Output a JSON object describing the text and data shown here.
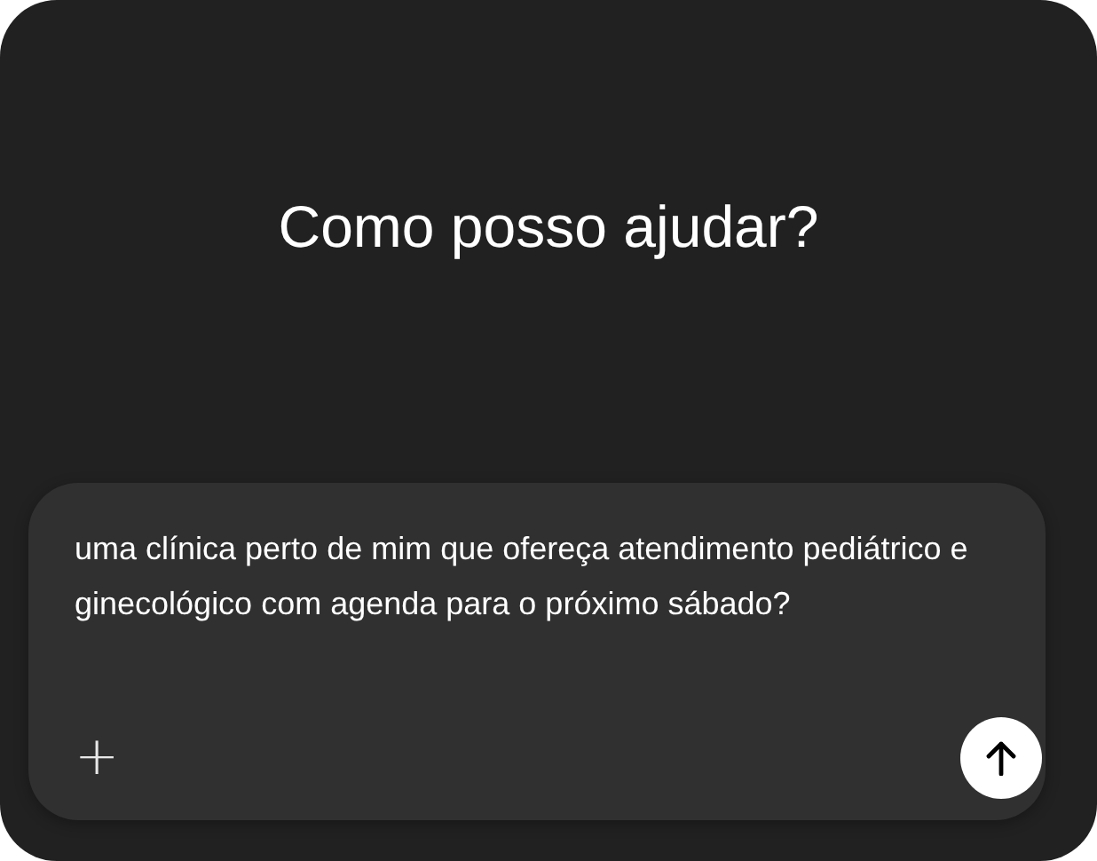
{
  "heading": "Como posso ajudar?",
  "composer": {
    "value": "uma clínica perto de mim que ofereça atendimento pediátrico e ginecológico com agenda para o próximo sábado?",
    "add_button": "+"
  }
}
